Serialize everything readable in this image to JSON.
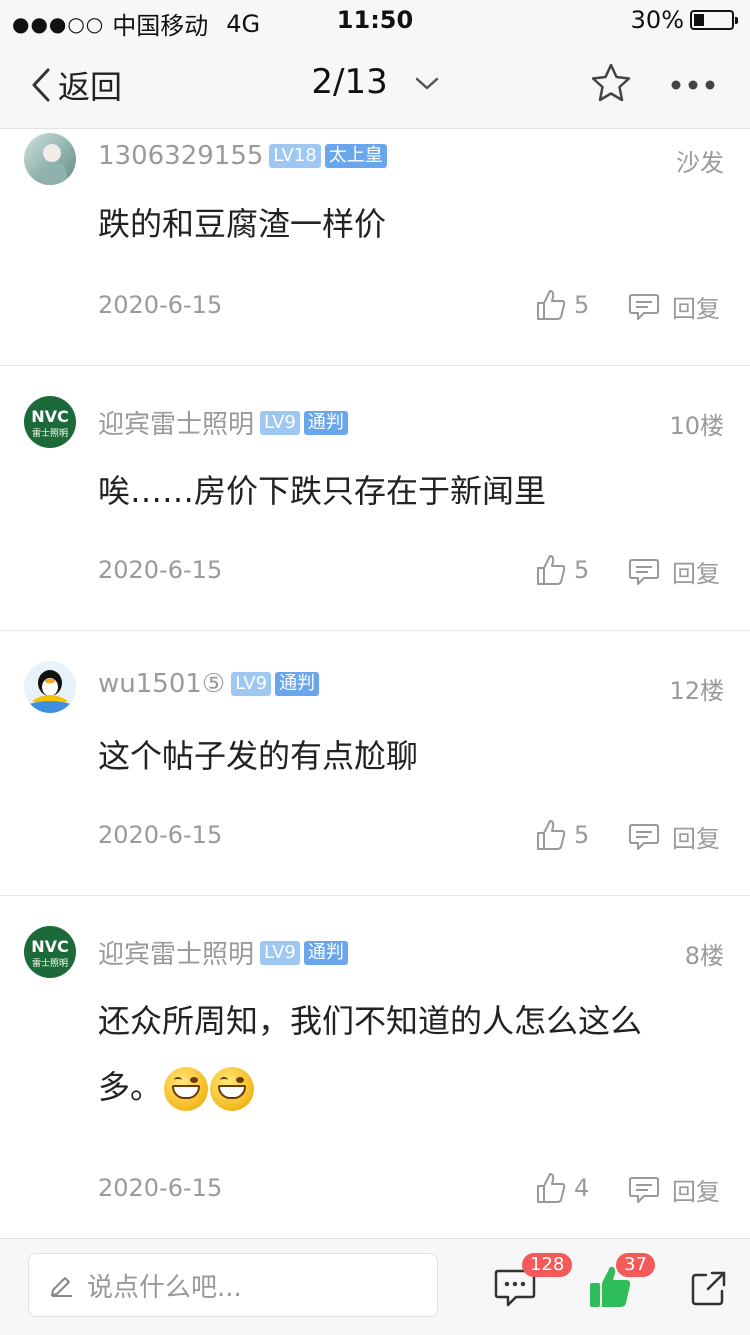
{
  "status_bar": {
    "signal_dots": "●●●○○",
    "carrier": "中国移动",
    "network": "4G",
    "time": "11:50",
    "battery": "30%"
  },
  "nav": {
    "back_label": "返回",
    "page_indicator": "2/13"
  },
  "posts": [
    {
      "username": "1306329155",
      "level": "LV18",
      "title": "太上皇",
      "floor": "沙发",
      "content": "跌的和豆腐渣一样价",
      "date": "2020-6-15",
      "likes": "5",
      "reply_label": "回复"
    },
    {
      "username": "迎宾雷士照明",
      "level": "LV9",
      "title": "通判",
      "floor": "10楼",
      "content": "唉……房价下跌只存在于新闻里",
      "date": "2020-6-15",
      "likes": "5",
      "reply_label": "回复"
    },
    {
      "username": "wu1501⑤",
      "level": "LV9",
      "title": "通判",
      "floor": "12楼",
      "content": "这个帖子发的有点尬聊",
      "date": "2020-6-15",
      "likes": "5",
      "reply_label": "回复"
    },
    {
      "username": "迎宾雷士照明",
      "level": "LV9",
      "title": "通判",
      "floor": "8楼",
      "content_line1": "还众所周知，我们不知道的人怎么这么",
      "content_line2": "多。",
      "date": "2020-6-15",
      "likes": "4",
      "reply_label": "回复"
    }
  ],
  "avatars": {
    "nvc_logo_text": "NVC",
    "nvc_sub_text": "雷士照明"
  },
  "bottom_bar": {
    "input_placeholder": "说点什么吧...",
    "comment_count": "128",
    "like_count": "37"
  },
  "colors": {
    "level_badge": "#9ec7f2",
    "title_badge": "#6aa6ec",
    "like_green": "#2ebd59",
    "notif_red": "#f45a5a"
  }
}
